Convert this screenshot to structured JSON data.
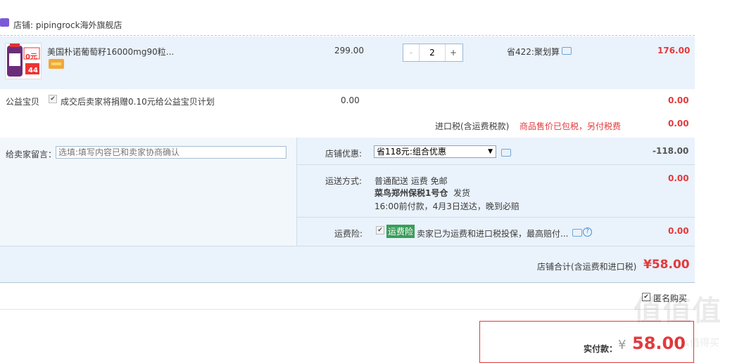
{
  "store": {
    "label": "店铺: pipingrock海外旗舰店"
  },
  "item": {
    "title": "美国朴诺葡萄籽16000mg90粒...",
    "thumb_badge": "0元",
    "thumb_price": "44",
    "unit_price": "299.00",
    "qty_minus": "-",
    "qty_plus": "+",
    "quantity": "2",
    "promo": "省422:聚划算",
    "total": "176.00"
  },
  "charity": {
    "label": "公益宝贝",
    "check": "✔",
    "text": "成交后卖家将捐赠0.10元给公益宝贝计划",
    "price": "0.00",
    "total": "0.00"
  },
  "import_tax": {
    "label": "进口税(含运费税款)",
    "note": "商品售价已包税，另付税费",
    "total": "0.00"
  },
  "memo": {
    "label": "给卖家留言：",
    "placeholder": "选填:填写内容已和卖家协商确认"
  },
  "discount": {
    "label": "店铺优惠:",
    "selected": "省118元:组合优惠",
    "arrow": "▼",
    "total": "-118.00"
  },
  "shipping": {
    "label": "运送方式:",
    "method": "普通配送 运费 免邮",
    "warehouse": "菜鸟郑州保税1号仓",
    "warehouse_suffix": "发货",
    "eta": "16:00前付款，4月3日送达，晚到必赔",
    "total": "0.00"
  },
  "insurance": {
    "label": "运费险:",
    "check": "✔",
    "tag": "运费险",
    "text": "卖家已为运费和进口税投保，最高赔付...",
    "help": "?",
    "total": "0.00"
  },
  "shop_total": {
    "label": "店铺合计(含运费和进口税)",
    "value": "¥58.00"
  },
  "anonymous": {
    "check": "✔",
    "label": "匿名购买"
  },
  "payment": {
    "label": "实付款：",
    "currency": "¥",
    "value": "58.00"
  },
  "watermark": {
    "text": "值值值",
    "sub": "什么值得买"
  },
  "colors": {
    "accent": "#e4393c",
    "row_bg": "#eaf2fb",
    "border": "#cfdde9"
  }
}
